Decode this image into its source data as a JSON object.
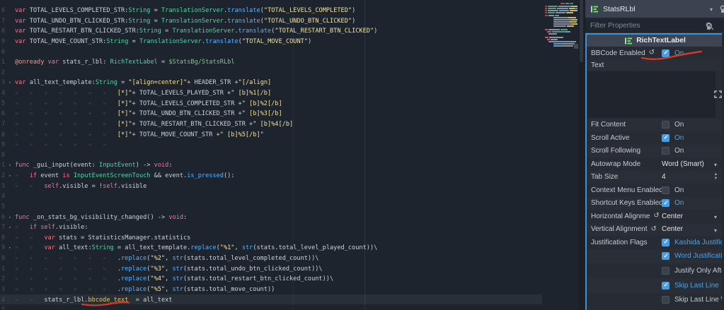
{
  "editor": {
    "guidelines": [
      414,
      515
    ],
    "lines": [
      {
        "n": "6",
        "segs": [
          [
            "kw",
            "var"
          ],
          [
            "pln",
            " TOTAL_LEVELS_COMPLETED_STR:"
          ],
          [
            "typ",
            "String"
          ],
          [
            "pln",
            " = "
          ],
          [
            "typ",
            "TranslationServer"
          ],
          [
            "pln",
            "."
          ],
          [
            "fn",
            "translate"
          ],
          [
            "pln",
            "("
          ],
          [
            "str",
            "\"TOTAL_LEVELS_COMPLETED\""
          ],
          [
            "pln",
            ")"
          ]
        ]
      },
      {
        "n": "7",
        "segs": [
          [
            "kw",
            "var"
          ],
          [
            "pln",
            " TOTAL_UNDO_BTN_CLICKED_STR:"
          ],
          [
            "typ",
            "String"
          ],
          [
            "pln",
            " = "
          ],
          [
            "typ",
            "TranslationServer"
          ],
          [
            "pln",
            "."
          ],
          [
            "fn",
            "translate"
          ],
          [
            "pln",
            "("
          ],
          [
            "str",
            "\"TOTAL_UNDO_BTN_CLICKED\""
          ],
          [
            "pln",
            ")"
          ]
        ]
      },
      {
        "n": "8",
        "segs": [
          [
            "kw",
            "var"
          ],
          [
            "pln",
            " TOTAL_RESTART_BTN_CLICKED_STR:"
          ],
          [
            "typ",
            "String"
          ],
          [
            "pln",
            " = "
          ],
          [
            "typ",
            "TranslationServer"
          ],
          [
            "pln",
            "."
          ],
          [
            "fn",
            "translate"
          ],
          [
            "pln",
            "("
          ],
          [
            "str",
            "\"TOTAL_RESTART_BTN_CLICKED\""
          ],
          [
            "pln",
            ")"
          ]
        ]
      },
      {
        "n": "9",
        "segs": [
          [
            "kw",
            "var"
          ],
          [
            "pln",
            " TOTAL_MOVE_COUNT_STR:"
          ],
          [
            "typ",
            "String"
          ],
          [
            "pln",
            " = "
          ],
          [
            "typ",
            "TranslationServer"
          ],
          [
            "pln",
            "."
          ],
          [
            "fn",
            "translate"
          ],
          [
            "pln",
            "("
          ],
          [
            "str",
            "\"TOTAL_MOVE_COUNT\""
          ],
          [
            "pln",
            ")"
          ]
        ]
      },
      {
        "n": "0",
        "segs": []
      },
      {
        "n": "1",
        "segs": [
          [
            "ann",
            "@onready"
          ],
          [
            "pln",
            " "
          ],
          [
            "kw",
            "var"
          ],
          [
            "pln",
            " stats_r_lbl: "
          ],
          [
            "typ",
            "RichTextLabel"
          ],
          [
            "pln",
            " = "
          ],
          [
            "path",
            "$StatsBg/StatsRLbl"
          ]
        ]
      },
      {
        "n": "2",
        "segs": []
      },
      {
        "n": "3",
        "fold": true,
        "segs": [
          [
            "kw",
            "var"
          ],
          [
            "pln",
            " all_text_template:"
          ],
          [
            "typ",
            "String"
          ],
          [
            "pln",
            " = "
          ],
          [
            "str",
            "\"[align=center]\""
          ],
          [
            "pln",
            "+ HEADER_STR +"
          ],
          [
            "str",
            "\"[/align]"
          ]
        ]
      },
      {
        "n": "4",
        "tabs": 7,
        "segs": [
          [
            "str",
            "[*]\""
          ],
          [
            "pln",
            "+ TOTAL_LEVELS_PLAYED_STR +"
          ],
          [
            "str",
            "\" [b]%1[/b]"
          ]
        ]
      },
      {
        "n": "5",
        "tabs": 7,
        "segs": [
          [
            "str",
            "[*]\""
          ],
          [
            "pln",
            "+ TOTAL_LEVELS_COMPLETED_STR +"
          ],
          [
            "str",
            "\" [b]%2[/b]"
          ]
        ]
      },
      {
        "n": "6",
        "tabs": 7,
        "segs": [
          [
            "str",
            "[*]\""
          ],
          [
            "pln",
            "+ TOTAL_UNDO_BTN_CLICKED_STR +"
          ],
          [
            "str",
            "\" [b]%3[/b]"
          ]
        ]
      },
      {
        "n": "7",
        "tabs": 7,
        "segs": [
          [
            "str",
            "[*]\""
          ],
          [
            "pln",
            "+ TOTAL_RESTART_BTN_CLICKED_STR +"
          ],
          [
            "str",
            "\" [b]%4[/b]"
          ]
        ]
      },
      {
        "n": "8",
        "tabs": 7,
        "segs": [
          [
            "str",
            "[*]\""
          ],
          [
            "pln",
            "+ TOTAL_MOVE_COUNT_STR +"
          ],
          [
            "str",
            "\" [b]%5[/b]\""
          ]
        ]
      },
      {
        "n": "9",
        "tabs": 7,
        "segs": []
      },
      {
        "n": "0",
        "segs": []
      },
      {
        "n": "1",
        "fold": true,
        "segs": [
          [
            "kw",
            "func"
          ],
          [
            "pln",
            " _gui_input(event: "
          ],
          [
            "typ",
            "InputEvent"
          ],
          [
            "pln",
            ") -> "
          ],
          [
            "kw",
            "void"
          ],
          [
            "pln",
            ":"
          ]
        ]
      },
      {
        "n": "2",
        "fold": true,
        "tabs": 1,
        "segs": [
          [
            "kw",
            "if"
          ],
          [
            "pln",
            " event "
          ],
          [
            "kw",
            "is"
          ],
          [
            "pln",
            " "
          ],
          [
            "typ",
            "InputEventScreenTouch"
          ],
          [
            "pln",
            " && event."
          ],
          [
            "fn",
            "is_pressed"
          ],
          [
            "pln",
            "():"
          ]
        ]
      },
      {
        "n": "3",
        "tabs": 2,
        "segs": [
          [
            "kw",
            "self"
          ],
          [
            "pln",
            ".visible = !"
          ],
          [
            "kw",
            "self"
          ],
          [
            "pln",
            ".visible"
          ]
        ]
      },
      {
        "n": "4",
        "segs": []
      },
      {
        "n": "5",
        "segs": []
      },
      {
        "n": "6",
        "fold": true,
        "segs": [
          [
            "kw",
            "func"
          ],
          [
            "pln",
            " _on_stats_bg_visibility_changed() -> "
          ],
          [
            "kw",
            "void"
          ],
          [
            "pln",
            ":"
          ]
        ]
      },
      {
        "n": "7",
        "fold": true,
        "tabs": 1,
        "segs": [
          [
            "kw",
            "if"
          ],
          [
            "pln",
            " "
          ],
          [
            "kw",
            "self"
          ],
          [
            "pln",
            ".visible:"
          ]
        ]
      },
      {
        "n": "8",
        "tabs": 2,
        "segs": [
          [
            "kw",
            "var"
          ],
          [
            "pln",
            " stats = StatisticsManager.statistics"
          ]
        ]
      },
      {
        "n": "9",
        "fold": true,
        "tabs": 2,
        "segs": [
          [
            "kw",
            "var"
          ],
          [
            "pln",
            " all_text:"
          ],
          [
            "typ",
            "String"
          ],
          [
            "pln",
            " = all_text_template."
          ],
          [
            "fn",
            "replace"
          ],
          [
            "pln",
            "("
          ],
          [
            "str",
            "\"%1\""
          ],
          [
            "pln",
            ", "
          ],
          [
            "fn",
            "str"
          ],
          [
            "pln",
            "(stats.total_level_played_count))\\"
          ]
        ]
      },
      {
        "n": "0",
        "tabs": 7,
        "segs": [
          [
            "pln",
            "."
          ],
          [
            "fn",
            "replace"
          ],
          [
            "pln",
            "("
          ],
          [
            "str",
            "\"%2\""
          ],
          [
            "pln",
            ", "
          ],
          [
            "fn",
            "str"
          ],
          [
            "pln",
            "(stats.total_level_completed_count))\\"
          ]
        ]
      },
      {
        "n": "1",
        "tabs": 7,
        "segs": [
          [
            "pln",
            "."
          ],
          [
            "fn",
            "replace"
          ],
          [
            "pln",
            "("
          ],
          [
            "str",
            "\"%3\""
          ],
          [
            "pln",
            ", "
          ],
          [
            "fn",
            "str"
          ],
          [
            "pln",
            "(stats.total_undo_btn_clicked_count))\\"
          ]
        ]
      },
      {
        "n": "2",
        "tabs": 7,
        "segs": [
          [
            "pln",
            "."
          ],
          [
            "fn",
            "replace"
          ],
          [
            "pln",
            "("
          ],
          [
            "str",
            "\"%4\""
          ],
          [
            "pln",
            ", "
          ],
          [
            "fn",
            "str"
          ],
          [
            "pln",
            "(stats.total_restart_btn_clicked_count))\\"
          ]
        ]
      },
      {
        "n": "3",
        "tabs": 7,
        "segs": [
          [
            "pln",
            "."
          ],
          [
            "fn",
            "replace"
          ],
          [
            "pln",
            "("
          ],
          [
            "str",
            "\"%5\""
          ],
          [
            "pln",
            ", "
          ],
          [
            "fn",
            "str"
          ],
          [
            "pln",
            "(stats.total_move_count))"
          ]
        ]
      },
      {
        "n": "4",
        "tabs": 2,
        "caret": true,
        "segs": [
          [
            "pln",
            "stats_r_lbl."
          ],
          [
            "gold",
            "bbcode_text"
          ],
          [
            "pln",
            "  = all_text"
          ]
        ]
      },
      {
        "n": "5",
        "segs": []
      }
    ]
  },
  "minimap": {
    "blocks": [
      [
        24,
        0,
        6,
        2,
        "#b14d52"
      ],
      [
        31,
        0,
        5,
        2,
        "#4f9e66"
      ],
      [
        37,
        0,
        5,
        2,
        "#3f8b7a"
      ],
      [
        2,
        4,
        3,
        2,
        "#a94b50"
      ],
      [
        6,
        4,
        14,
        2,
        "#5a9a7d"
      ],
      [
        21,
        4,
        18,
        2,
        "#8a93a1"
      ],
      [
        39,
        4,
        9,
        2,
        "#c7b96b"
      ],
      [
        2,
        7,
        3,
        2,
        "#a94b50"
      ],
      [
        6,
        7,
        12,
        2,
        "#5a9a7d"
      ],
      [
        19,
        7,
        16,
        2,
        "#8a93a1"
      ],
      [
        36,
        7,
        8,
        2,
        "#c7b96b"
      ],
      [
        44,
        7,
        4,
        2,
        "#5b8fd4"
      ],
      [
        2,
        10,
        3,
        2,
        "#a94b50"
      ],
      [
        6,
        10,
        15,
        2,
        "#8a93a1"
      ],
      [
        22,
        10,
        14,
        2,
        "#6f97c4"
      ],
      [
        37,
        10,
        11,
        2,
        "#c7b96b"
      ],
      [
        2,
        13,
        3,
        2,
        "#a94b50"
      ],
      [
        6,
        13,
        10,
        2,
        "#5a9a7d"
      ],
      [
        17,
        13,
        14,
        2,
        "#8a93a1"
      ],
      [
        32,
        13,
        10,
        2,
        "#c7b96b"
      ],
      [
        2,
        17,
        4,
        2,
        "#a94b50"
      ],
      [
        7,
        17,
        8,
        2,
        "#8a93a1"
      ],
      [
        16,
        17,
        6,
        2,
        "#5a9a7d"
      ],
      [
        14,
        20,
        20,
        2,
        "#8a93a1"
      ],
      [
        34,
        20,
        12,
        2,
        "#c7b96b"
      ],
      [
        14,
        23,
        24,
        2,
        "#8a93a1"
      ],
      [
        38,
        23,
        10,
        2,
        "#c7b96b"
      ],
      [
        14,
        26,
        22,
        2,
        "#8a93a1"
      ],
      [
        36,
        26,
        11,
        2,
        "#c7b96b"
      ],
      [
        14,
        29,
        25,
        2,
        "#8a93a1"
      ],
      [
        39,
        29,
        9,
        2,
        "#c7b96b"
      ],
      [
        14,
        32,
        18,
        2,
        "#8a93a1"
      ],
      [
        33,
        32,
        10,
        2,
        "#c7b96b"
      ],
      [
        2,
        37,
        4,
        2,
        "#c05a6a"
      ],
      [
        7,
        37,
        16,
        2,
        "#8a93a1"
      ],
      [
        24,
        37,
        10,
        2,
        "#5a9a7d"
      ],
      [
        5,
        40,
        6,
        2,
        "#c05a6a"
      ],
      [
        12,
        40,
        18,
        2,
        "#5a9a7d"
      ],
      [
        30,
        40,
        8,
        2,
        "#6f97c4"
      ],
      [
        7,
        43,
        12,
        2,
        "#8a93a1"
      ],
      [
        2,
        48,
        5,
        2,
        "#c05a6a"
      ],
      [
        8,
        48,
        20,
        2,
        "#8a93a1"
      ],
      [
        5,
        51,
        4,
        2,
        "#c05a6a"
      ],
      [
        10,
        51,
        10,
        2,
        "#8a93a1"
      ],
      [
        7,
        54,
        14,
        2,
        "#8a93a1"
      ],
      [
        21,
        54,
        16,
        2,
        "#6f97c4"
      ],
      [
        37,
        54,
        9,
        2,
        "#8a93a1"
      ],
      [
        14,
        57,
        10,
        2,
        "#6f97c4"
      ],
      [
        24,
        57,
        20,
        2,
        "#8a93a1"
      ],
      [
        14,
        60,
        12,
        2,
        "#6f97c4"
      ],
      [
        26,
        60,
        16,
        2,
        "#8a93a1"
      ],
      [
        43,
        58,
        6,
        7,
        "#434b57"
      ]
    ]
  },
  "annotations": {
    "color": "#cf3a2c"
  },
  "inspector": {
    "node_name": "StatsRLbl",
    "filter_placeholder": "Filter Properties",
    "category": "RichTextLabel",
    "bbcode": {
      "label": "BBCode Enabled",
      "on": "On",
      "checked": true
    },
    "text": {
      "label": "Text"
    },
    "fit": {
      "label": "Fit Content",
      "on": "On",
      "checked": false
    },
    "scroll_active": {
      "label": "Scroll Active",
      "on": "On",
      "checked": true
    },
    "scroll_following": {
      "label": "Scroll Following",
      "on": "On",
      "checked": false
    },
    "autowrap": {
      "label": "Autowrap Mode",
      "value": "Word (Smart)"
    },
    "tab_size": {
      "label": "Tab Size",
      "value": "4"
    },
    "context_menu": {
      "label": "Context Menu Enabled",
      "on": "On",
      "checked": false
    },
    "shortcut_keys": {
      "label": "Shortcut Keys Enabled",
      "on": "On",
      "checked": true
    },
    "horizontal": {
      "label": "Horizontal Alignme",
      "value": "Center"
    },
    "vertical": {
      "label": "Vertical Alignment",
      "value": "Center"
    },
    "justification": {
      "label": "Justification Flags"
    },
    "flags": [
      {
        "label": "Kashida Justificatio",
        "checked": true
      },
      {
        "label": "Word Justification",
        "checked": true
      },
      {
        "label": "Justify Only After L",
        "checked": false
      },
      {
        "label": "Skip Last Line",
        "checked": true
      },
      {
        "label": "Skip Last Line With",
        "checked": false
      }
    ]
  }
}
